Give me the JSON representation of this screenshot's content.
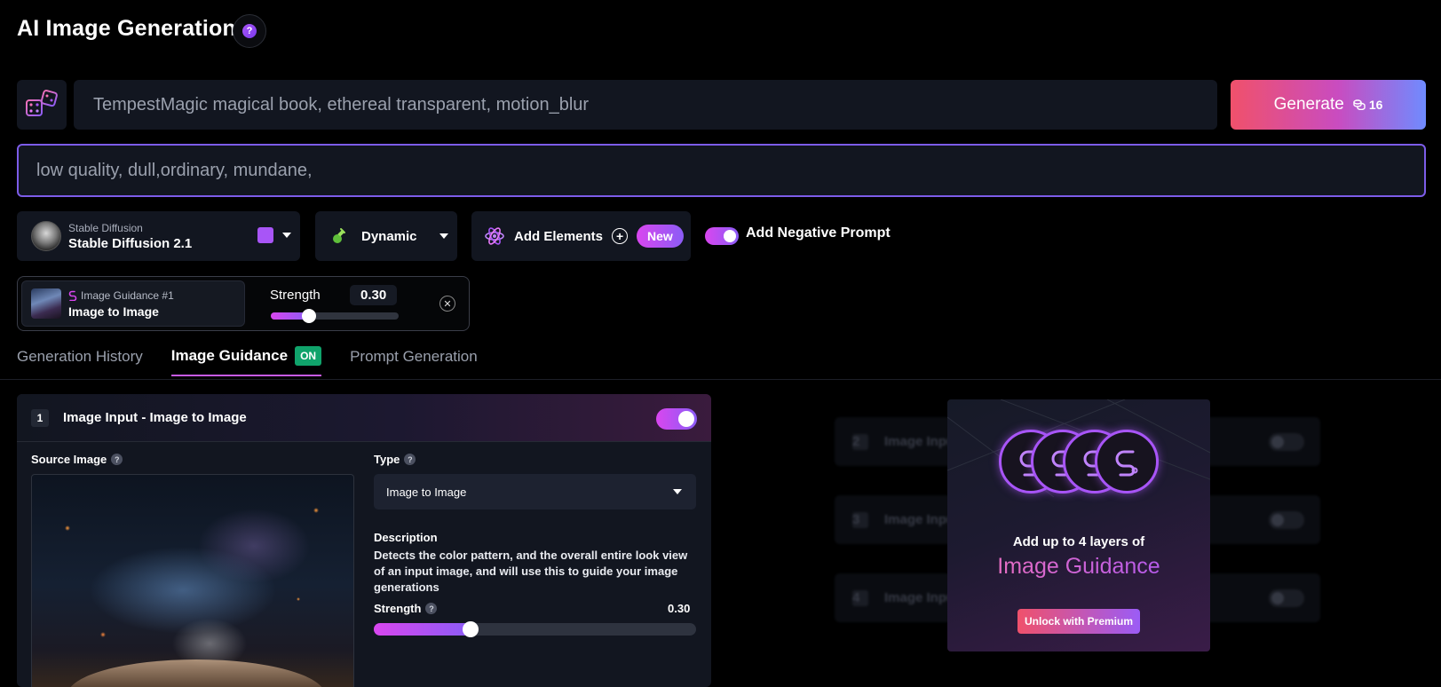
{
  "header": {
    "title": "AI Image Generation",
    "help_icon": "question-icon",
    "help_glyph": "?"
  },
  "prompt": {
    "value": "TempestMagic magical book, ethereal transparent, motion_blur",
    "random_icon": "dice-icon"
  },
  "generate": {
    "label": "Generate",
    "cost": "16",
    "cost_icon": "coins-icon"
  },
  "negative_prompt": {
    "value": "low quality, dull,ordinary, mundane,"
  },
  "model": {
    "family": "Stable Diffusion",
    "name": "Stable Diffusion 2.1"
  },
  "style": {
    "label": "Dynamic",
    "icon": "potion-icon"
  },
  "elements": {
    "label": "Add Elements",
    "badge": "New",
    "icon": "atom-icon"
  },
  "negative_toggle": {
    "label": "Add Negative Prompt",
    "on": true
  },
  "guidance_chip": {
    "sub": "Image Guidance #1",
    "main": "Image to Image",
    "strength_label": "Strength",
    "strength_value": "0.30",
    "strength_fraction": 0.3,
    "close_glyph": "✕"
  },
  "tabs": [
    {
      "label": "Generation History",
      "active": false
    },
    {
      "label": "Image Guidance",
      "active": true,
      "badge": "ON"
    },
    {
      "label": "Prompt Generation",
      "active": false
    }
  ],
  "panel": {
    "number": "1",
    "title": "Image Input - Image to Image",
    "enabled": true,
    "source_label": "Source Image",
    "type_label": "Type",
    "type_value": "Image to Image",
    "desc_title": "Description",
    "desc_text": "Detects the color pattern, and the overall entire look view of an input image, and will use this to guide your image generations",
    "strength_label": "Strength",
    "strength_value": "0.30",
    "strength_fraction": 0.3,
    "help_glyph": "?"
  },
  "locked_rows": [
    {
      "number": "2",
      "label": "Image Input"
    },
    {
      "number": "3",
      "label": "Image Input"
    },
    {
      "number": "4",
      "label": "Image Input"
    }
  ],
  "premium": {
    "line1": "Add up to 4 layers of",
    "line2": "Image Guidance",
    "button": "Unlock with Premium"
  },
  "colors": {
    "accent_purple": "#a855f7",
    "accent_pink": "#d946ef",
    "generate_start": "#f0516b",
    "generate_end": "#6f8bff",
    "on_badge": "#10a36b",
    "background": "#000000",
    "surface": "#121620"
  }
}
